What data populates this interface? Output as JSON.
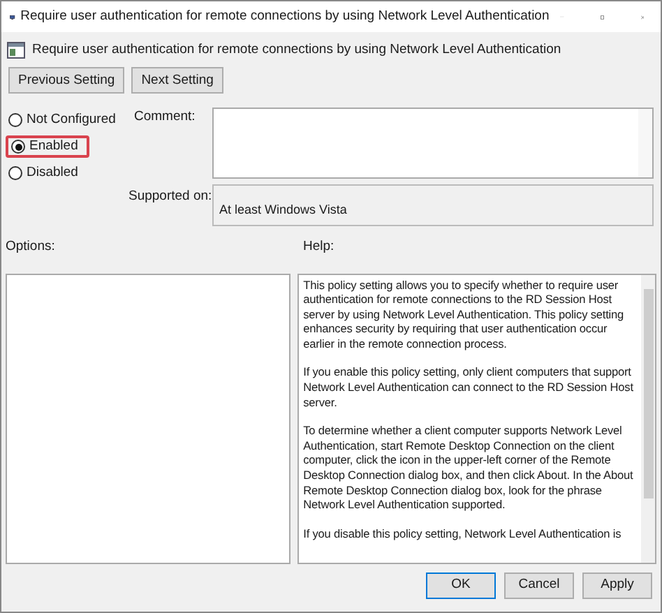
{
  "window": {
    "title": "Require user authentication for remote connections by using Network Level Authentication"
  },
  "heading": "Require user authentication for remote connections by using Network Level Authentication",
  "nav_buttons": [
    "Previous Setting",
    "Next Setting"
  ],
  "state_options": [
    {
      "label": "Not Configured",
      "selected": false,
      "highlighted": false
    },
    {
      "label": "Enabled",
      "selected": true,
      "highlighted": true
    },
    {
      "label": "Disabled",
      "selected": false,
      "highlighted": false
    }
  ],
  "comment": {
    "label": "Comment:"
  },
  "supported_on": {
    "label": "Supported on:",
    "value": "At least Windows Vista"
  },
  "options": {
    "label": "Options:"
  },
  "help": {
    "label": "Help:",
    "paragraphs": [
      "This policy setting allows you to specify whether to require user authentication for remote connections to the RD Session Host server by using Network Level Authentication. This policy setting enhances security by requiring that user authentication occur earlier in the remote connection process.",
      "If you enable this policy setting, only client computers that support Network Level Authentication can connect to the RD Session Host server.",
      "To determine whether a client computer supports Network Level Authentication, start Remote Desktop Connection on the client computer, click the icon in the upper-left corner of the Remote Desktop Connection dialog box, and then click About. In the About Remote Desktop Connection dialog box, look for the phrase Network Level Authentication supported.",
      "If you disable this policy setting, Network Level Authentication is"
    ]
  },
  "buttons": [
    {
      "label": "OK",
      "default": true
    },
    {
      "label": "Cancel",
      "default": false
    },
    {
      "label": "Apply",
      "default": false
    }
  ]
}
